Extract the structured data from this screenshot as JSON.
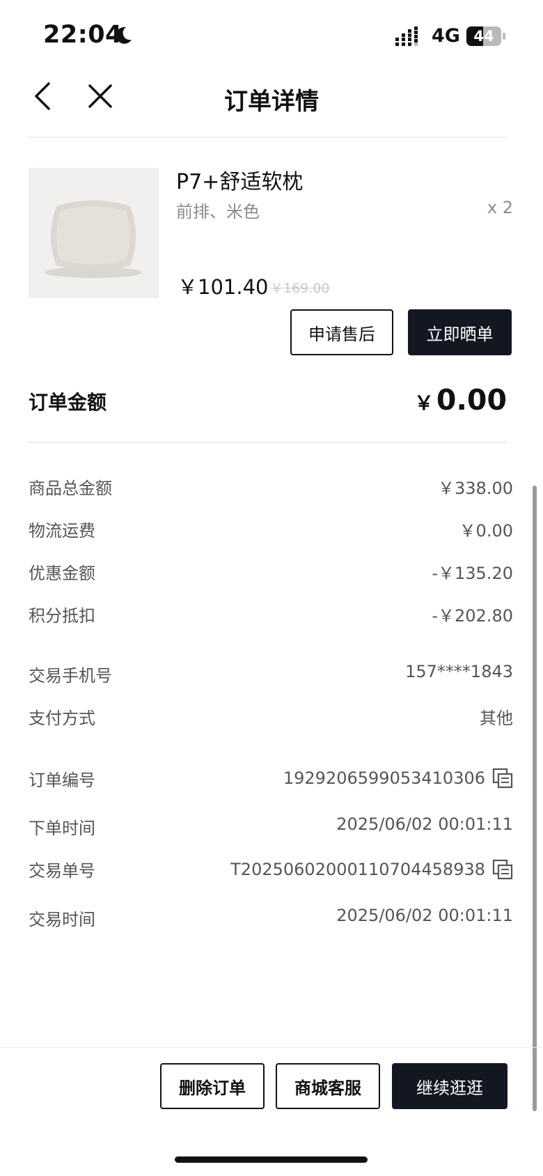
{
  "status_bar": {
    "time": "22:04",
    "network": "4G",
    "battery": "44"
  },
  "header": {
    "title": "订单详情"
  },
  "product": {
    "name": "P7+舒适软枕",
    "variant": "前排、米色",
    "quantity": "x 2",
    "price": "￥101.40",
    "original_price": "￥169.00",
    "buttons": {
      "after_sales": "申请售后",
      "share_review": "立即晒单"
    }
  },
  "order_amount": {
    "label": "订单金额",
    "currency": "￥",
    "value": "0.00"
  },
  "details": [
    {
      "label": "商品总金额",
      "value": "￥338.00"
    },
    {
      "label": "物流运费",
      "value": "￥0.00"
    },
    {
      "label": "优惠金额",
      "value": "-￥135.20"
    },
    {
      "label": "积分抵扣",
      "value": "-￥202.80"
    },
    {
      "label": "交易手机号",
      "value": "157****1843"
    },
    {
      "label": "支付方式",
      "value": "其他"
    },
    {
      "label": "订单编号",
      "value": "1929206599053410306"
    },
    {
      "label": "下单时间",
      "value": "2025/06/02 00:01:11"
    },
    {
      "label": "交易单号",
      "value": "T2025060200011070445893​8"
    },
    {
      "label": "交易时间",
      "value": "2025/06/02 00:01:11"
    }
  ],
  "footer": {
    "delete": "删除订单",
    "service": "商城客服",
    "continue": "继续逛逛"
  },
  "colors": {
    "dark_button": "#121722",
    "muted_text": "#8a8a8a",
    "divider": "#ededed"
  }
}
